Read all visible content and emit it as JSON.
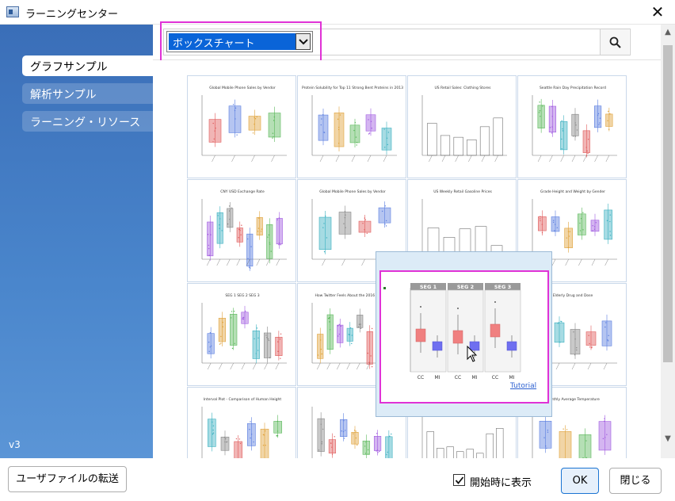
{
  "window": {
    "title": "ラーニングセンター",
    "close_glyph": "✕"
  },
  "sidebar": {
    "items": [
      {
        "label": "グラフサンプル",
        "active": true
      },
      {
        "label": "解析サンプル",
        "active": false
      },
      {
        "label": "ラーニング・リソース",
        "active": false
      }
    ],
    "version": "v3"
  },
  "search": {
    "category_selected": "ボックスチャート",
    "query": "",
    "icon": "search-icon"
  },
  "gallery": {
    "thumbnails": [
      "Global Mobile Phone Sales by Vendor",
      "Protein Solubility for Top 11 Strong Bent Proteins in 2013",
      "US Retail Sales: Clothing Stores",
      "Seattle Rain Day Precipitation Record",
      "CNY USD Exchange Rate",
      "Global Mobile Phone Sales by Vendor",
      "US Weekly Retail Gasoline Prices",
      "Grade Height and Weight by Gender",
      "SEG 1 SEG 2 SEG 3",
      "How Twitter Feels About the 2016 Election",
      "",
      "Elderly Drug and Dose",
      "Interval Plot - Comparison of Human Height",
      "",
      "",
      "Monthly Average Temperature"
    ]
  },
  "preview": {
    "segments": [
      "SEG 1",
      "SEG 2",
      "SEG 3"
    ],
    "groups": [
      "CC",
      "MI"
    ],
    "link": "Tutorial"
  },
  "footer": {
    "transfer_label": "ユーザファイルの転送",
    "show_on_start_label": "開始時に表示",
    "show_on_start_checked": true,
    "ok_label": "OK",
    "close_label": "閉じる"
  },
  "colors": {
    "sidebar": "#4a86cc",
    "highlight": "#e032d6",
    "selection": "#0a64d8"
  }
}
